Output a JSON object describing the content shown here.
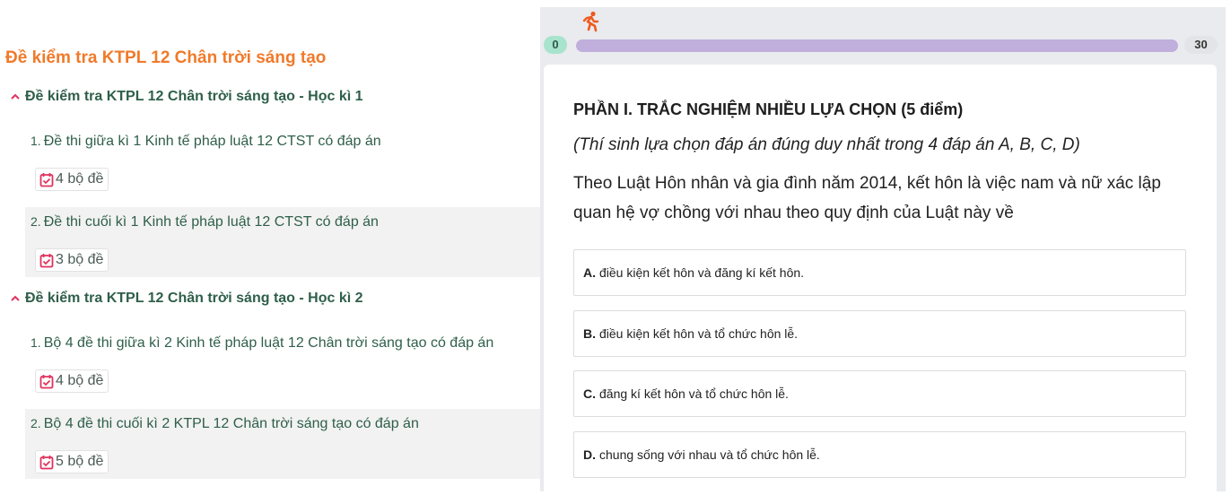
{
  "left_panel": {
    "title": "Đề kiểm tra KTPL 12 Chân trời sáng tạo",
    "sections": [
      {
        "title": "Đề kiểm tra KTPL 12 Chân trời sáng tạo - Học kì 1",
        "items": [
          {
            "number": "1.",
            "label": "Đề thi giữa kì 1 Kinh tế pháp luật 12 CTST có đáp án",
            "badge": "4 bộ đề"
          },
          {
            "number": "2.",
            "label": "Đề thi cuối kì 1 Kinh tế pháp luật 12 CTST có đáp án",
            "badge": "3 bộ đề"
          }
        ]
      },
      {
        "title": "Đề kiểm tra KTPL 12 Chân trời sáng tạo - Học kì 2",
        "items": [
          {
            "number": "1.",
            "label": "Bộ 4 đề thi giữa kì 2 Kinh tế pháp luật 12 Chân trời sáng tạo có đáp án",
            "badge": "4 bộ đề"
          },
          {
            "number": "2.",
            "label": "Bộ 4 đề thi cuối kì 2 KTPL 12 Chân trời sáng tạo có đáp án",
            "badge": "5 bộ đề"
          }
        ]
      }
    ]
  },
  "progress": {
    "start_label": "0",
    "end_label": "30",
    "fill_fraction": 1.0,
    "runner_icon": "running-person-icon"
  },
  "quiz": {
    "part_title": "PHẦN I. TRẮC NGHIỆM NHIỀU LỰA CHỌN (5 điểm)",
    "instruction": "(Thí sinh lựa chọn đáp án đúng duy nhất trong 4 đáp án A, B, C, D)",
    "question": "Theo Luật Hôn nhân và gia đình năm 2014, kết hôn là việc nam và nữ xác lập quan hệ vợ chồng với nhau theo quy định của Luật này về",
    "options": [
      {
        "letter": "A.",
        "text": "điều kiện kết hôn và đăng kí kết hôn."
      },
      {
        "letter": "B.",
        "text": "điều kiện kết hôn và tổ chức hôn lễ."
      },
      {
        "letter": "C.",
        "text": "đăng kí kết hôn và tổ chức hôn lễ."
      },
      {
        "letter": "D.",
        "text": "chung sống với nhau và tổ chức hôn lễ."
      }
    ]
  },
  "colors": {
    "title_orange": "#f07a2a",
    "text_green": "#2f5f4a",
    "badge_icon_red": "#e0335e",
    "progress_purple": "#c0aedc",
    "start_pill_green": "#a7e3cd",
    "runner_orange": "#f05a1e"
  }
}
